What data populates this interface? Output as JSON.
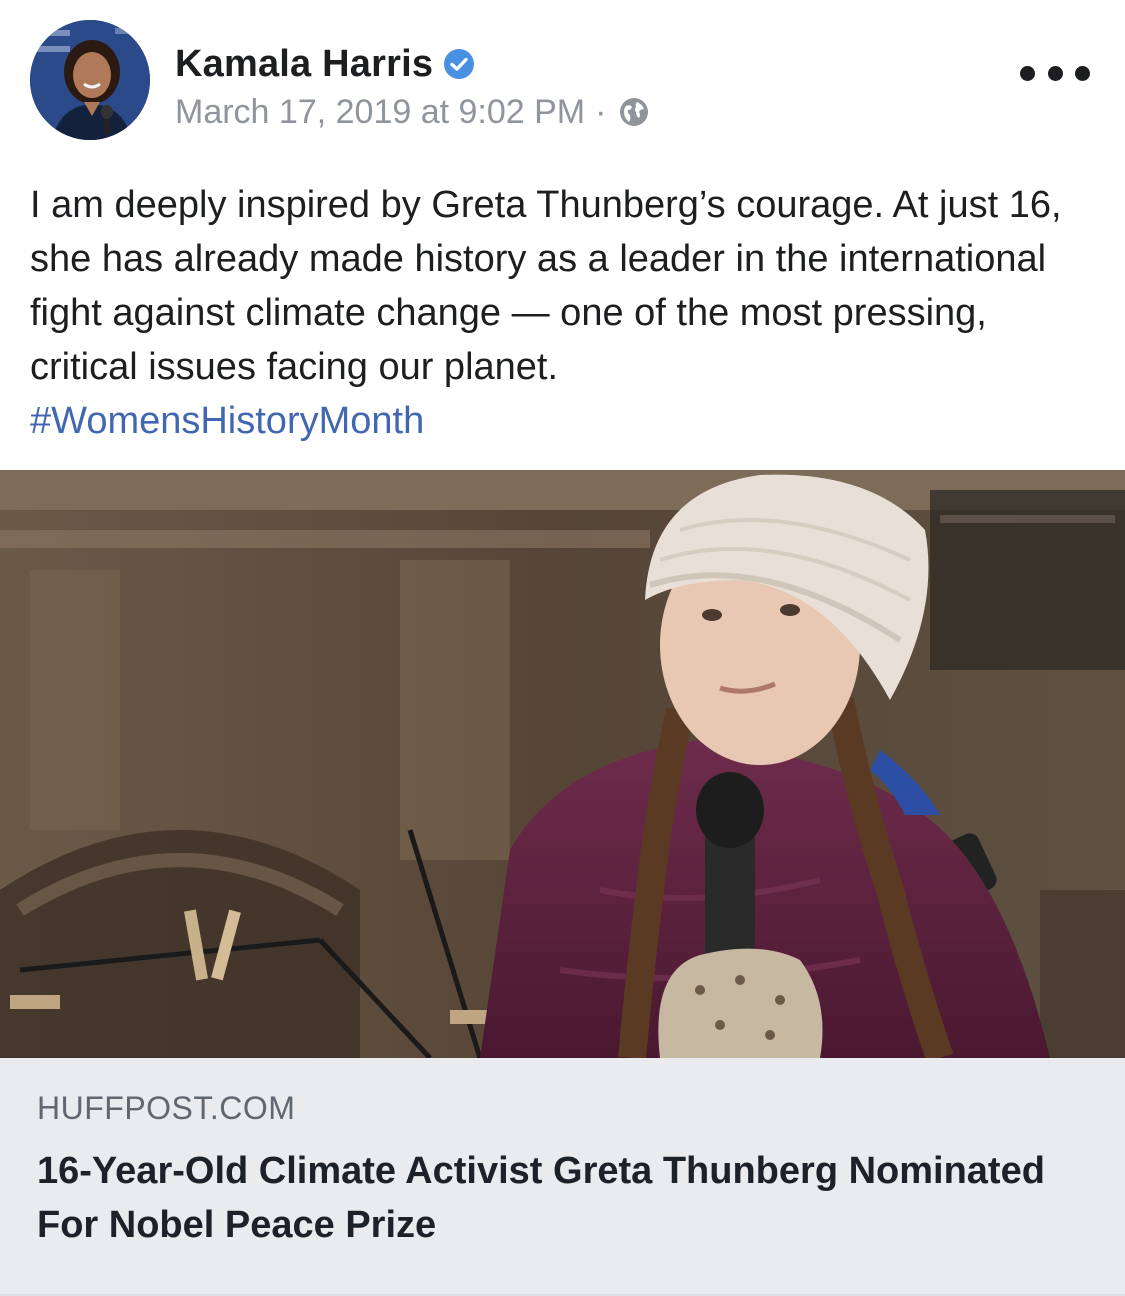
{
  "post": {
    "author": {
      "name": "Kamala Harris",
      "verified": true,
      "avatar_icon": "profile-photo"
    },
    "timestamp": "March 17, 2019 at 9:02 PM",
    "meta_separator": "·",
    "privacy_icon": "globe-icon",
    "more_icon": "more-options-icon",
    "text": "I am deeply inspired by Greta Thunberg’s courage. At just 16, she has already made history as a leader in the international fight against climate change — one of the most pressing, critical issues facing our planet.",
    "hashtag": "#WomensHistoryMonth",
    "link_preview": {
      "domain": "HUFFPOST.COM",
      "title": "16-Year-Old Climate Activist Greta Thunberg Nominated For Nobel Peace Prize"
    }
  },
  "colors": {
    "text": "#1c1e21",
    "meta": "#90949c",
    "link_blue": "#4267b2",
    "verified_blue": "#4a90e2",
    "card_background": "#e9ebee",
    "jacket": "#5e2440"
  }
}
